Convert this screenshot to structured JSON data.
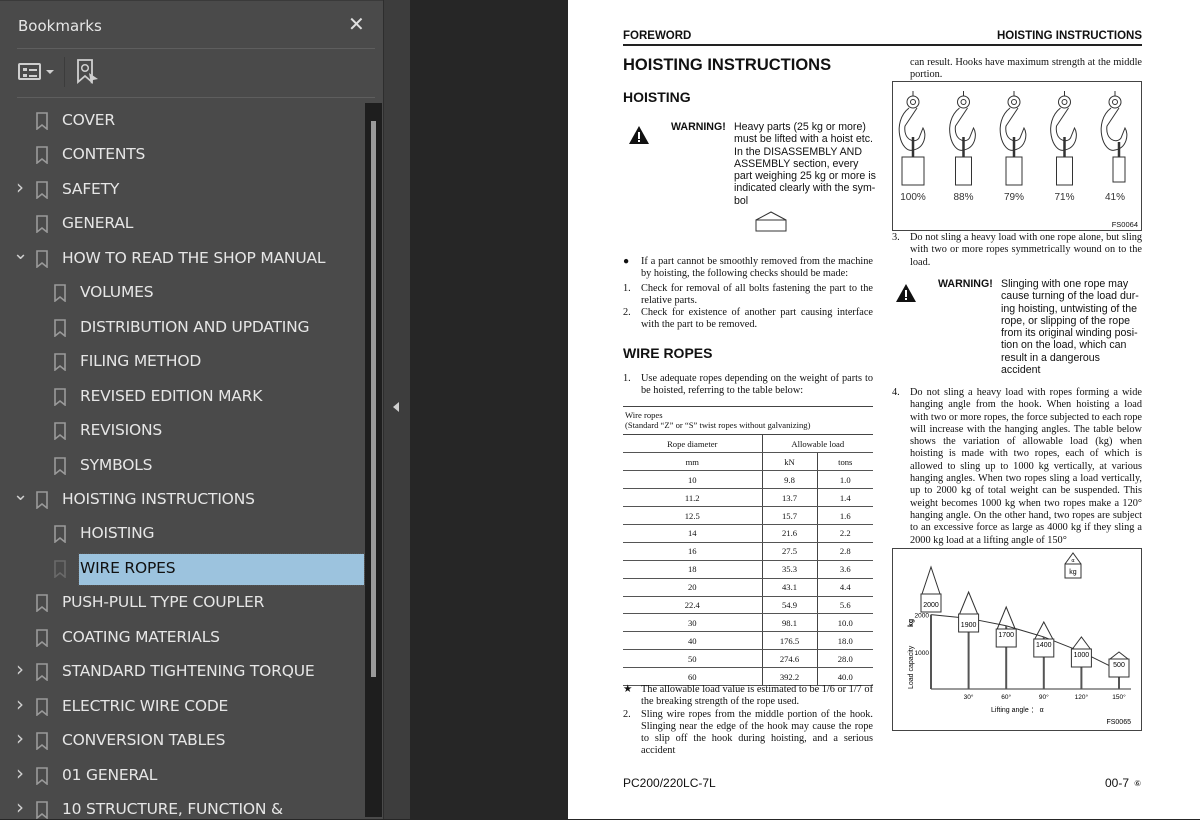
{
  "sidebar": {
    "title": "Bookmarks",
    "close_icon": "close-icon",
    "options_icon": "list-options-icon",
    "find_icon": "find-current-bookmark-icon",
    "items": [
      {
        "label": "COVER",
        "level": 1,
        "state": "leaf"
      },
      {
        "label": "CONTENTS",
        "level": 1,
        "state": "leaf"
      },
      {
        "label": "SAFETY",
        "level": 1,
        "state": "collapsed"
      },
      {
        "label": "GENERAL",
        "level": 1,
        "state": "leaf"
      },
      {
        "label": "HOW TO READ THE SHOP MANUAL",
        "level": 1,
        "state": "expanded"
      },
      {
        "label": "VOLUMES",
        "level": 2,
        "state": "leaf"
      },
      {
        "label": "DISTRIBUTION AND UPDATING",
        "level": 2,
        "state": "leaf"
      },
      {
        "label": "FILING METHOD",
        "level": 2,
        "state": "leaf"
      },
      {
        "label": "REVISED EDITION MARK",
        "level": 2,
        "state": "leaf"
      },
      {
        "label": "REVISIONS",
        "level": 2,
        "state": "leaf"
      },
      {
        "label": "SYMBOLS",
        "level": 2,
        "state": "leaf"
      },
      {
        "label": "HOISTING INSTRUCTIONS",
        "level": 1,
        "state": "expanded"
      },
      {
        "label": "HOISTING",
        "level": 2,
        "state": "leaf"
      },
      {
        "label": "WIRE ROPES",
        "level": 2,
        "state": "leaf",
        "selected": true
      },
      {
        "label": "PUSH-PULL TYPE COUPLER",
        "level": 1,
        "state": "leaf"
      },
      {
        "label": "COATING MATERIALS",
        "level": 1,
        "state": "leaf"
      },
      {
        "label": "STANDARD TIGHTENING TORQUE",
        "level": 1,
        "state": "collapsed"
      },
      {
        "label": "ELECTRIC WIRE CODE",
        "level": 1,
        "state": "collapsed"
      },
      {
        "label": "CONVERSION TABLES",
        "level": 1,
        "state": "collapsed"
      },
      {
        "label": "01 GENERAL",
        "level": 1,
        "state": "collapsed"
      },
      {
        "label": "10 STRUCTURE, FUNCTION &",
        "level": 1,
        "state": "collapsed"
      }
    ]
  },
  "page": {
    "header_left": "FOREWORD",
    "header_right": "HOISTING INSTRUCTIONS",
    "title": "HOISTING INSTRUCTIONS",
    "section_hoisting": "HOISTING",
    "warning_label": "WARNING!",
    "warning1": "Heavy parts (25 kg or more) must be lifted with a hoist etc. In the DISASSEMBLY AND ASSEMBLY section, every part weighing 25 kg or more is indicated clearly with the sym-bol",
    "bullet_intro": "If a part cannot be smoothly removed from the machine by hoisting, the following checks should be made:",
    "check1": "Check for removal of all bolts fastening the part to the relative parts.",
    "check2": "Check for existence of another part causing interface with the part to be removed.",
    "section_wire": "WIRE ROPES",
    "wire1": "Use adequate ropes depending on the weight of parts to be hoisted, referring to the table below:",
    "table": {
      "caption1": "Wire ropes",
      "caption2": "(Standard “Z” or “S” twist ropes without galvanizing)",
      "col_diameter": "Rope diameter",
      "col_load": "Allowable load",
      "unit_mm": "mm",
      "unit_kn": "kN",
      "unit_tons": "tons",
      "rows": [
        [
          "10",
          "9.8",
          "1.0"
        ],
        [
          "11.2",
          "13.7",
          "1.4"
        ],
        [
          "12.5",
          "15.7",
          "1.6"
        ],
        [
          "14",
          "21.6",
          "2.2"
        ],
        [
          "16",
          "27.5",
          "2.8"
        ],
        [
          "18",
          "35.3",
          "3.6"
        ],
        [
          "20",
          "43.1",
          "4.4"
        ],
        [
          "22.4",
          "54.9",
          "5.6"
        ],
        [
          "30",
          "98.1",
          "10.0"
        ],
        [
          "40",
          "176.5",
          "18.0"
        ],
        [
          "50",
          "274.6",
          "28.0"
        ],
        [
          "60",
          "392.2",
          "40.0"
        ]
      ]
    },
    "star_note": "The allowable load value is estimated to be 1/6 or 1/7 of the breaking strength of the rope used.",
    "wire2": "Sling wire ropes from the middle portion of the hook. Slinging near the edge of the hook may cause the rope to slip off the hook during hoisting, and a serious accident",
    "wire2_cont": "can result. Hooks have maximum strength at the middle portion.",
    "hooks": {
      "percentages": [
        "100%",
        "88%",
        "79%",
        "71%",
        "41%"
      ],
      "fig_id": "FS0064"
    },
    "item3": "Do not sling a heavy load with one rope alone, but sling with two or more ropes symmetrically wound on to the load.",
    "warning2": "Slinging with one rope may cause turning of the load dur-ing hoisting, untwisting of the rope, or slipping of the rope from its original winding posi-tion on the load, which can result in a dangerous accident",
    "item4": "Do not sling a heavy load with ropes forming a wide hanging angle from the hook. When hoisting a load with two or more ropes, the force subjected to each rope will increase with the hanging angles. The table below shows the variation of allowable load (kg) when hoisting is made with two ropes, each of which is allowed to sling up to 1000 kg vertically, at various hanging angles. When two ropes sling a load vertically, up to 2000 kg of total weight can be suspended. This weight becomes 1000 kg when two ropes make a 120° hanging angle. On the other hand, two ropes are subject to an excessive force as large as 4000 kg if they sling a 2000 kg load at a lifting angle of 150°",
    "diagram": {
      "ylabel": "Load capacity",
      "yunit": "kg",
      "xlabel": "Lifting angle ： α",
      "legend_alpha": "α",
      "legend_unit": "kg",
      "y_ticks": [
        "2000",
        "1000"
      ],
      "angles": [
        0,
        30,
        60,
        90,
        120,
        150
      ],
      "x_tick_labels": [
        "30°",
        "60°",
        "90°",
        "120°",
        "150°"
      ],
      "loads": [
        2000,
        1900,
        1700,
        1400,
        1000,
        500
      ],
      "load_labels": [
        "2000",
        "1900",
        "1700",
        "1400",
        "1000",
        "500"
      ],
      "fig_id": "FS0065"
    },
    "footer_model": "PC200/220LC-7L",
    "footer_page": "00-7",
    "footer_rev": "⑥"
  }
}
